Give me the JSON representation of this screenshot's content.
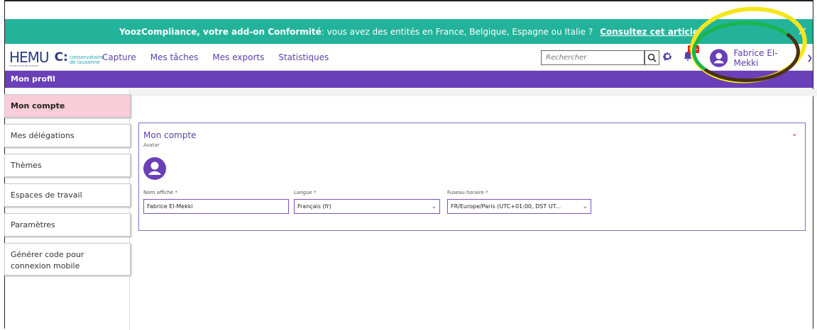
{
  "banner": {
    "bold_text": "YoozCompliance, votre add-on Conformité",
    "text": " : vous avez des entités en France, Belgique, Espagne ou Italie ?",
    "link": "Consultez cet article",
    "close": "✕"
  },
  "logo": {
    "he": "HEMU",
    "he_sub": "HAUTE ÉCOLE DE MUSIQUE",
    "c": "C:",
    "cons1": "conservatoire",
    "cons2": "de lausanne"
  },
  "nav": {
    "items": [
      "Capture",
      "Mes tâches",
      "Mes exports",
      "Statistiques"
    ]
  },
  "search": {
    "placeholder": "Rechercher"
  },
  "notifications": {
    "badge": "9+"
  },
  "user": {
    "name": "Fabrice El-Mekki"
  },
  "profile_bar": {
    "title": "Mon profil"
  },
  "sidebar": {
    "items": [
      "Mon compte",
      "Mes délégations",
      "Thèmes",
      "Espaces de travail",
      "Paramètres",
      "Générer code pour connexion mobile"
    ]
  },
  "account": {
    "title": "Mon compte",
    "avatar_label": "Avatar",
    "display_name_label": "Nom affiché *",
    "display_name": "Fabrice El-Mekki",
    "language_label": "Langue *",
    "language": "Français (fr)",
    "timezone_label": "Fuseau horaire *",
    "timezone": "FR/Europe/Paris (UTC+01:00, DST UT..."
  },
  "colors": {
    "banner": "#22b39a",
    "accent": "#6a3fb8",
    "active_item": "#f9ccd9",
    "badge": "#e02020"
  }
}
